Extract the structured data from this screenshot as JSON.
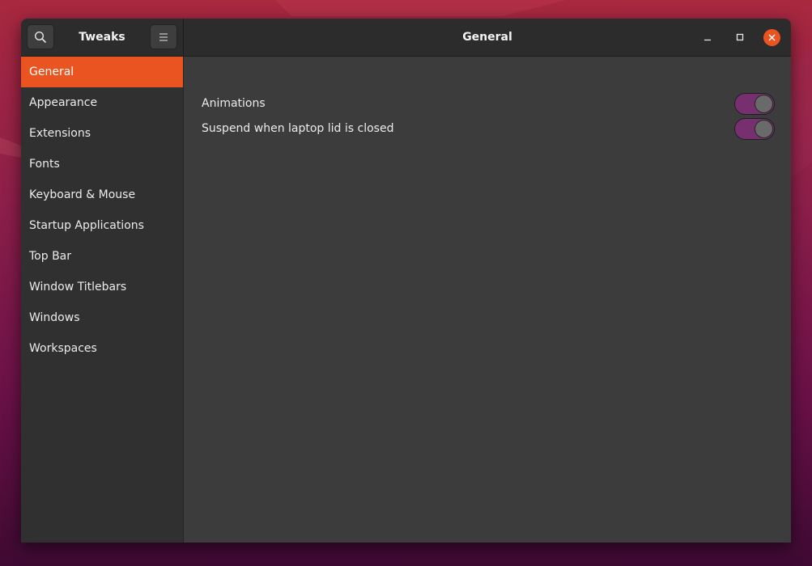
{
  "app": {
    "title": "Tweaks",
    "page_title": "General"
  },
  "header": {
    "search_icon": "search-icon",
    "menu_icon": "hamburger-menu-icon",
    "window_controls": [
      "minimize-icon",
      "maximize-icon",
      "close-icon"
    ]
  },
  "sidebar": {
    "items": [
      {
        "label": "General",
        "active": true
      },
      {
        "label": "Appearance",
        "active": false
      },
      {
        "label": "Extensions",
        "active": false
      },
      {
        "label": "Fonts",
        "active": false
      },
      {
        "label": "Keyboard & Mouse",
        "active": false
      },
      {
        "label": "Startup Applications",
        "active": false
      },
      {
        "label": "Top Bar",
        "active": false
      },
      {
        "label": "Window Titlebars",
        "active": false
      },
      {
        "label": "Windows",
        "active": false
      },
      {
        "label": "Workspaces",
        "active": false
      }
    ]
  },
  "settings": [
    {
      "label": "Animations",
      "enabled": true
    },
    {
      "label": "Suspend when laptop lid is closed",
      "enabled": true
    }
  ],
  "colors": {
    "accent": "#e95420",
    "toggle_on": "#77306f",
    "window_bg": "#3c3c3c",
    "sidebar_bg": "#303030",
    "headerbar_bg": "#2c2c2c"
  }
}
